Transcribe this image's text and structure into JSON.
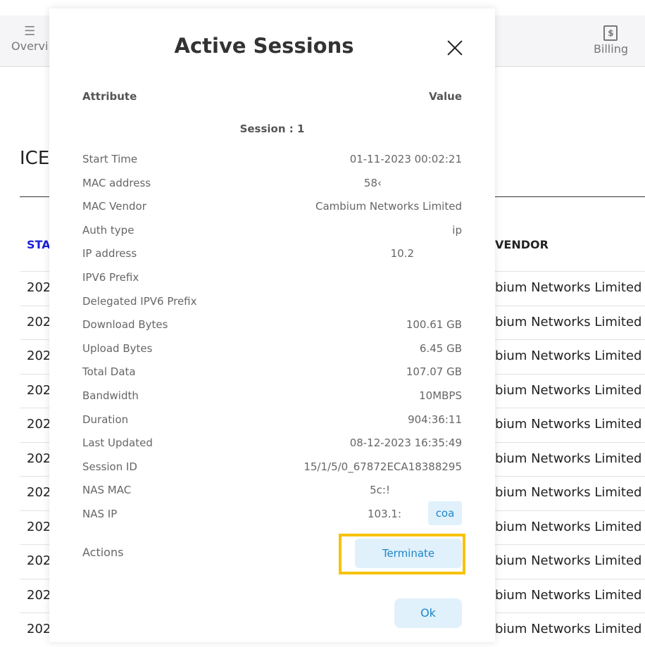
{
  "background": {
    "nav": {
      "overview_label": "Overvi",
      "billing_label": "Billing"
    },
    "heading": "ICE",
    "table": {
      "left_header": "STA",
      "right_header": "VENDOR",
      "rows": [
        {
          "left": "202",
          "right": "bium Networks Limited"
        },
        {
          "left": "202",
          "right": "bium Networks Limited"
        },
        {
          "left": "202",
          "right": "bium Networks Limited"
        },
        {
          "left": "202",
          "right": "bium Networks Limited"
        },
        {
          "left": "202",
          "right": "bium Networks Limited"
        },
        {
          "left": "202",
          "right": "bium Networks Limited"
        },
        {
          "left": "202",
          "right": "bium Networks Limited"
        },
        {
          "left": "202",
          "right": "bium Networks Limited"
        },
        {
          "left": "202",
          "right": "bium Networks Limited"
        },
        {
          "left": "202",
          "right": "bium Networks Limited"
        },
        {
          "left": "202",
          "right": "bium Networks Limited"
        }
      ]
    }
  },
  "modal": {
    "title": "Active Sessions",
    "header_attribute": "Attribute",
    "header_value": "Value",
    "session_label": "Session : 1",
    "attributes": [
      {
        "key": "Start Time",
        "value": "01-11-2023 00:02:21"
      },
      {
        "key": "MAC address",
        "value": "58‹"
      },
      {
        "key": "MAC Vendor",
        "value": "Cambium Networks Limited"
      },
      {
        "key": "Auth type",
        "value": "ip"
      },
      {
        "key": "IP address",
        "value": "10.2"
      },
      {
        "key": "IPV6 Prefix",
        "value": ""
      },
      {
        "key": "Delegated IPV6 Prefix",
        "value": ""
      },
      {
        "key": "Download Bytes",
        "value": "100.61 GB"
      },
      {
        "key": "Upload Bytes",
        "value": "6.45 GB"
      },
      {
        "key": "Total Data",
        "value": "107.07 GB"
      },
      {
        "key": "Bandwidth",
        "value": "10MBPS"
      },
      {
        "key": "Duration",
        "value": "904:36:11"
      },
      {
        "key": "Last Updated",
        "value": "08-12-2023 16:35:49"
      },
      {
        "key": "Session ID",
        "value": "15/1/5/0_67872ECA18388295"
      },
      {
        "key": "NAS MAC",
        "value": "5c:!"
      },
      {
        "key": "NAS IP",
        "value": "103.1:"
      }
    ],
    "coa_label": "coa",
    "actions_label": "Actions",
    "terminate_label": "Terminate",
    "ok_label": "Ok"
  },
  "colors": {
    "accent_button_bg": "#e0f1fb",
    "accent_button_text": "#1e86c8",
    "highlight_border": "#f7c20a",
    "table_header_link": "#1a1fd6"
  },
  "icons": {
    "overview": "list-icon",
    "billing": "billing-icon",
    "close": "close-icon"
  }
}
